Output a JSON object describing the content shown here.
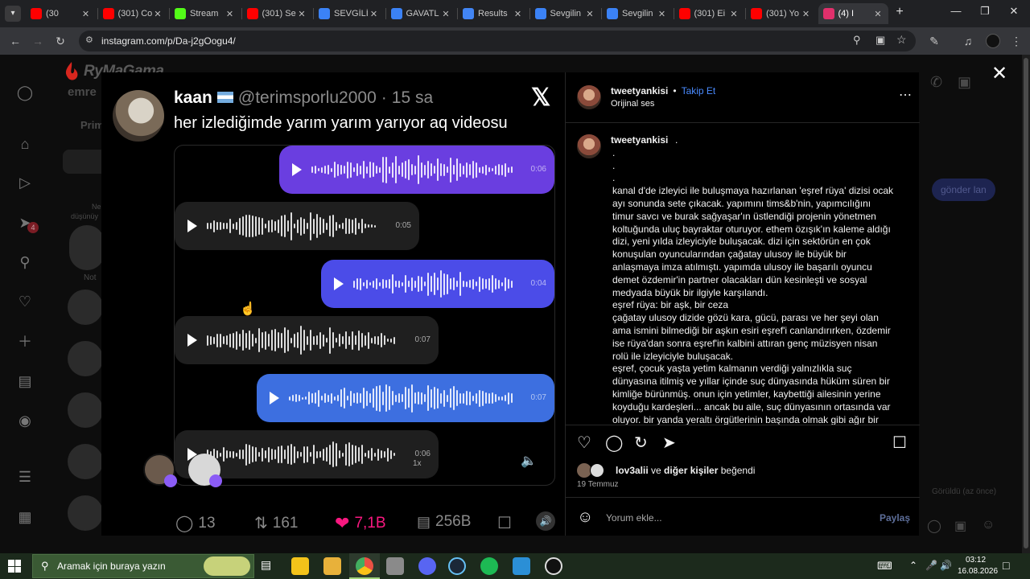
{
  "browser": {
    "tabs": [
      {
        "title": "(30",
        "favicon": "youtube-icon",
        "color": "#ff0000"
      },
      {
        "title": "(301) Co",
        "favicon": "youtube-icon",
        "color": "#ff0000"
      },
      {
        "title": "Stream",
        "favicon": "kick-icon",
        "color": "#53fc18"
      },
      {
        "title": "(301) Se",
        "favicon": "youtube-icon",
        "color": "#ff0000"
      },
      {
        "title": "SEVGİLİ",
        "favicon": "drive-icon",
        "color": "#3b82f6"
      },
      {
        "title": "GAVATL",
        "favicon": "drive-icon",
        "color": "#3b82f6"
      },
      {
        "title": "Results",
        "favicon": "google-icon",
        "color": "#4285f4"
      },
      {
        "title": "Sevgilin",
        "favicon": "drive-icon",
        "color": "#3b82f6"
      },
      {
        "title": "Sevgilin",
        "favicon": "drive-icon",
        "color": "#3b82f6"
      },
      {
        "title": "(301) Ei",
        "favicon": "youtube-icon",
        "color": "#ff0000"
      },
      {
        "title": "(301) Yo",
        "favicon": "youtube-icon",
        "color": "#ff0000"
      },
      {
        "title": "(4) I",
        "favicon": "instagram-icon",
        "color": "#e1306c"
      }
    ],
    "new_tab": "+",
    "url": "instagram.com/p/Da-j2gOogu4/"
  },
  "instagram": {
    "bg_profile_name": "emre",
    "bg_tab_label": "Prim",
    "bg_send_button": "gönder lan",
    "bg_seen": "Görüldü (az önce)",
    "bg_note_label": "Not",
    "bg_ne_label": "Ne",
    "bg_note_sub": "düşünüy",
    "watermark": "RyMaGama"
  },
  "tweet": {
    "display_name": "kaan",
    "handle": "@terimsporlu2000",
    "time": "15 sa",
    "text": "her izlediğimde yarım yarım yarıyor aq videosu",
    "voice_messages": [
      {
        "duration": "0:06",
        "style": "purple",
        "side": "right"
      },
      {
        "duration": "0:05",
        "style": "gray",
        "side": "left"
      },
      {
        "duration": "0:04",
        "style": "violet",
        "side": "right"
      },
      {
        "duration": "0:07",
        "style": "gray",
        "side": "left"
      },
      {
        "duration": "0:07",
        "style": "blue",
        "side": "right"
      },
      {
        "duration": "0:06",
        "style": "gray",
        "side": "left"
      }
    ],
    "speed": "1x",
    "replies": "13",
    "retweets": "161",
    "likes": "7,1B",
    "views": "256B"
  },
  "post": {
    "username": "tweetyankisi",
    "follow_label": "Takip Et",
    "audio_label": "Orijinal ses",
    "caption_username": "tweetyankisi",
    "caption_lines": [
      ".",
      ".",
      ".",
      ".",
      "kanal d'de izleyici ile buluşmaya hazırlanan 'eşref rüya' dizisi ocak",
      "ayı sonunda sete çıkacak. yapımını tims&b'nin, yapımcılığını",
      "timur savcı ve burak sağyaşar'ın üstlendiği projenin yönetmen",
      "koltuğunda uluç bayraktar oturuyor. ethem özışık'ın kaleme aldığı",
      "dizi, yeni yılda izleyiciyle buluşacak. dizi için sektörün en çok",
      "konuşulan oyuncularından çağatay ulusoy ile büyük bir",
      "anlaşmaya imza atılmıştı. yapımda ulusoy ile başarılı oyuncu",
      "demet özdemir'in partner olacakları dün kesinleşti ve sosyal",
      "medyada büyük bir ilgiyle karşılandı.",
      "eşref rüya: bir aşk, bir ceza",
      "çağatay ulusoy dizide gözü kara, gücü, parası ve her şeyi olan",
      "ama ismini bilmediği bir aşkın esiri eşref'i canlandırırken, özdemir",
      "ise rüya'dan sonra eşref'in kalbini attıran genç müzisyen nisan",
      "rolü ile izleyiciyle buluşacak.",
      "eşref, çocuk yaşta yetim kalmanın verdiği yalnızlıkla suç",
      "dünyasına itilmiş ve yıllar içinde suç dünyasında hüküm süren bir",
      "kimliğe bürünmüş. onun için yetimler, kaybettiği ailesinin yerine",
      "koyduğu kardeşleri... ancak bu aile, suç dünyasının ortasında var",
      "oluyor. bir yanda yeraltı örgütlerinin başında olmak gibi ağır bir"
    ],
    "likes_user": "lov3alii",
    "likes_rest": " ve ",
    "likes_others": "diğer kişiler",
    "likes_suffix": " beğendi",
    "date": "19 Temmuz",
    "comment_placeholder": "Yorum ekle...",
    "share_label": "Paylaş"
  },
  "taskbar": {
    "search_placeholder": "Aramak için buraya yazın",
    "time": "03:12",
    "date": "16.08.2026"
  }
}
